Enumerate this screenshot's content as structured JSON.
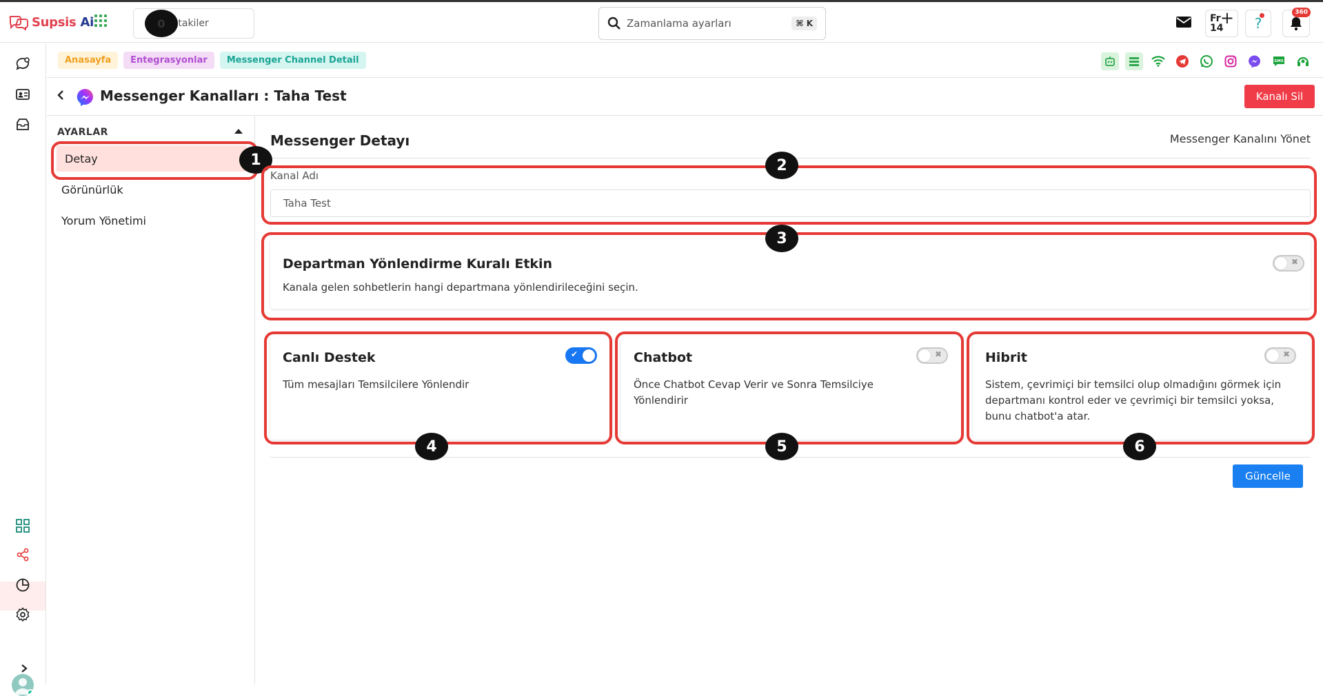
{
  "topbar": {
    "logo_prefix": "Supsis ",
    "logo_suffix": "Ai",
    "queue_count": "0",
    "queue_label": "Kuyruktakiler",
    "search_value": "Zamanlama ayarları",
    "search_shortcut": "⌘ K",
    "lang_label": "Fr",
    "lang_number": "14",
    "help_glyph": "?",
    "notification_badge": "360"
  },
  "breadcrumb": {
    "items": [
      "Anasayfa",
      "Entegrasyonlar",
      "Messenger Channel Detail"
    ]
  },
  "header": {
    "title": "Messenger Kanalları : Taha Test",
    "delete_label": "Kanalı Sil"
  },
  "sidebar": {
    "heading": "AYARLAR",
    "items": [
      "Detay",
      "Görünürlük",
      "Yorum Yönetimi"
    ]
  },
  "main": {
    "title": "Messenger Detayı",
    "manage_link": "Messenger Kanalını Yönet",
    "channel_name_label": "Kanal Adı",
    "channel_name_value": "Taha Test",
    "department": {
      "title": "Departman Yönlendirme Kuralı Etkin",
      "description": "Kanala gelen sohbetlerin hangi departmana yönlendirileceğini seçin.",
      "enabled": false
    },
    "modes": [
      {
        "title": "Canlı Destek",
        "description": "Tüm mesajları Temsilcilere Yönlendir",
        "enabled": true
      },
      {
        "title": "Chatbot",
        "description": "Önce Chatbot Cevap Verir ve Sonra Temsilciye Yönlendirir",
        "enabled": false
      },
      {
        "title": "Hibrit",
        "description": "Sistem, çevrimiçi bir temsilci olup olmadığını görmek için departmanı kontrol eder ve çevrimiçi bir temsilci yoksa, bunu chatbot'a atar.",
        "enabled": false
      }
    ],
    "update_label": "Güncelle"
  },
  "annotations": [
    "1",
    "2",
    "3",
    "4",
    "5",
    "6"
  ],
  "colors": {
    "accent": "#1877f2",
    "danger": "#f03c48",
    "highlight": "#e53935"
  },
  "icons": {
    "left_rail": [
      "chat-icon",
      "contacts-icon",
      "inbox-icon",
      "apps-grid-icon",
      "share-icon",
      "chart-icon",
      "settings-icon"
    ],
    "channels": [
      "bot-icon",
      "list-icon",
      "wifi-icon",
      "telegram-icon",
      "whatsapp-icon",
      "instagram-icon",
      "messenger-icon",
      "sms-icon",
      "support-icon"
    ]
  }
}
